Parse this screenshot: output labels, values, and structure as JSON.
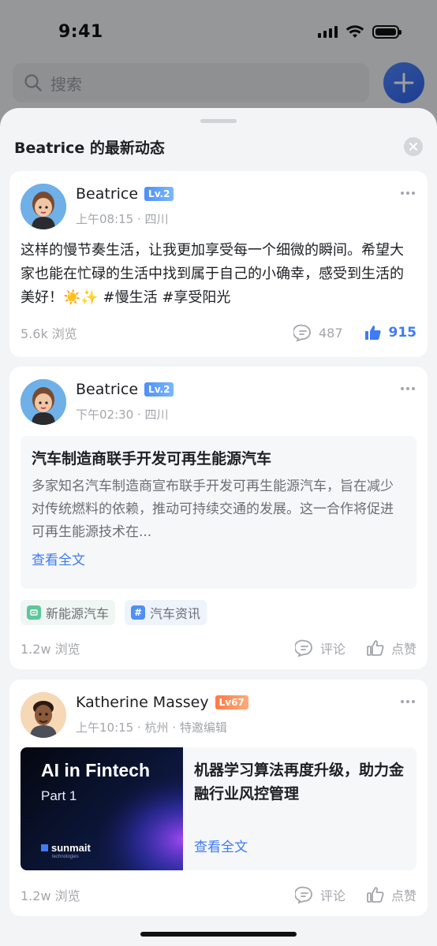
{
  "status_bar": {
    "time": "9:41"
  },
  "search": {
    "placeholder": "搜索"
  },
  "sheet": {
    "title": "Beatrice 的最新动态"
  },
  "posts": [
    {
      "author": "Beatrice",
      "level": "Lv.2",
      "meta": "上午08:15 · 四川",
      "text": "这样的慢节奏生活，让我更加享受每一个细微的瞬间。希望大家也能在忙碌的生活中找到属于自己的小确幸，感受到生活的美好！☀️✨ #慢生活 #享受阳光",
      "views": "5.6k 浏览",
      "comments": "487",
      "likes": "915"
    },
    {
      "author": "Beatrice",
      "level": "Lv.2",
      "meta": "下午02:30 · 四川",
      "article_title": "汽车制造商联手开发可再生能源汽车",
      "article_summary": "多家知名汽车制造商宣布联手开发可再生能源汽车，旨在减少对传统燃料的依赖，推动可持续交通的发展。这一合作将促进可再生能源技术在...",
      "read_more": "查看全文",
      "tags": [
        "新能源汽车",
        "汽车资讯"
      ],
      "views": "1.2w 浏览",
      "comment_label": "评论",
      "like_label": "点赞"
    },
    {
      "author": "Katherine Massey",
      "level": "Lv67",
      "meta": "上午10:15 · 杭州 · 特邀编辑",
      "thumb_title": "AI in Fintech",
      "thumb_sub": "Part 1",
      "thumb_brand": "sunmait",
      "thumb_brand_sub": "technologies",
      "article_title": "机器学习算法再度升级，助力金融行业风控管理",
      "read_more": "查看全文",
      "views": "1.2w 浏览",
      "comment_label": "评论",
      "like_label": "点赞"
    }
  ],
  "colors": {
    "accent": "#3e7bf5",
    "level_blue": "#4f8ff7",
    "level_orange": "#ff7a45"
  }
}
